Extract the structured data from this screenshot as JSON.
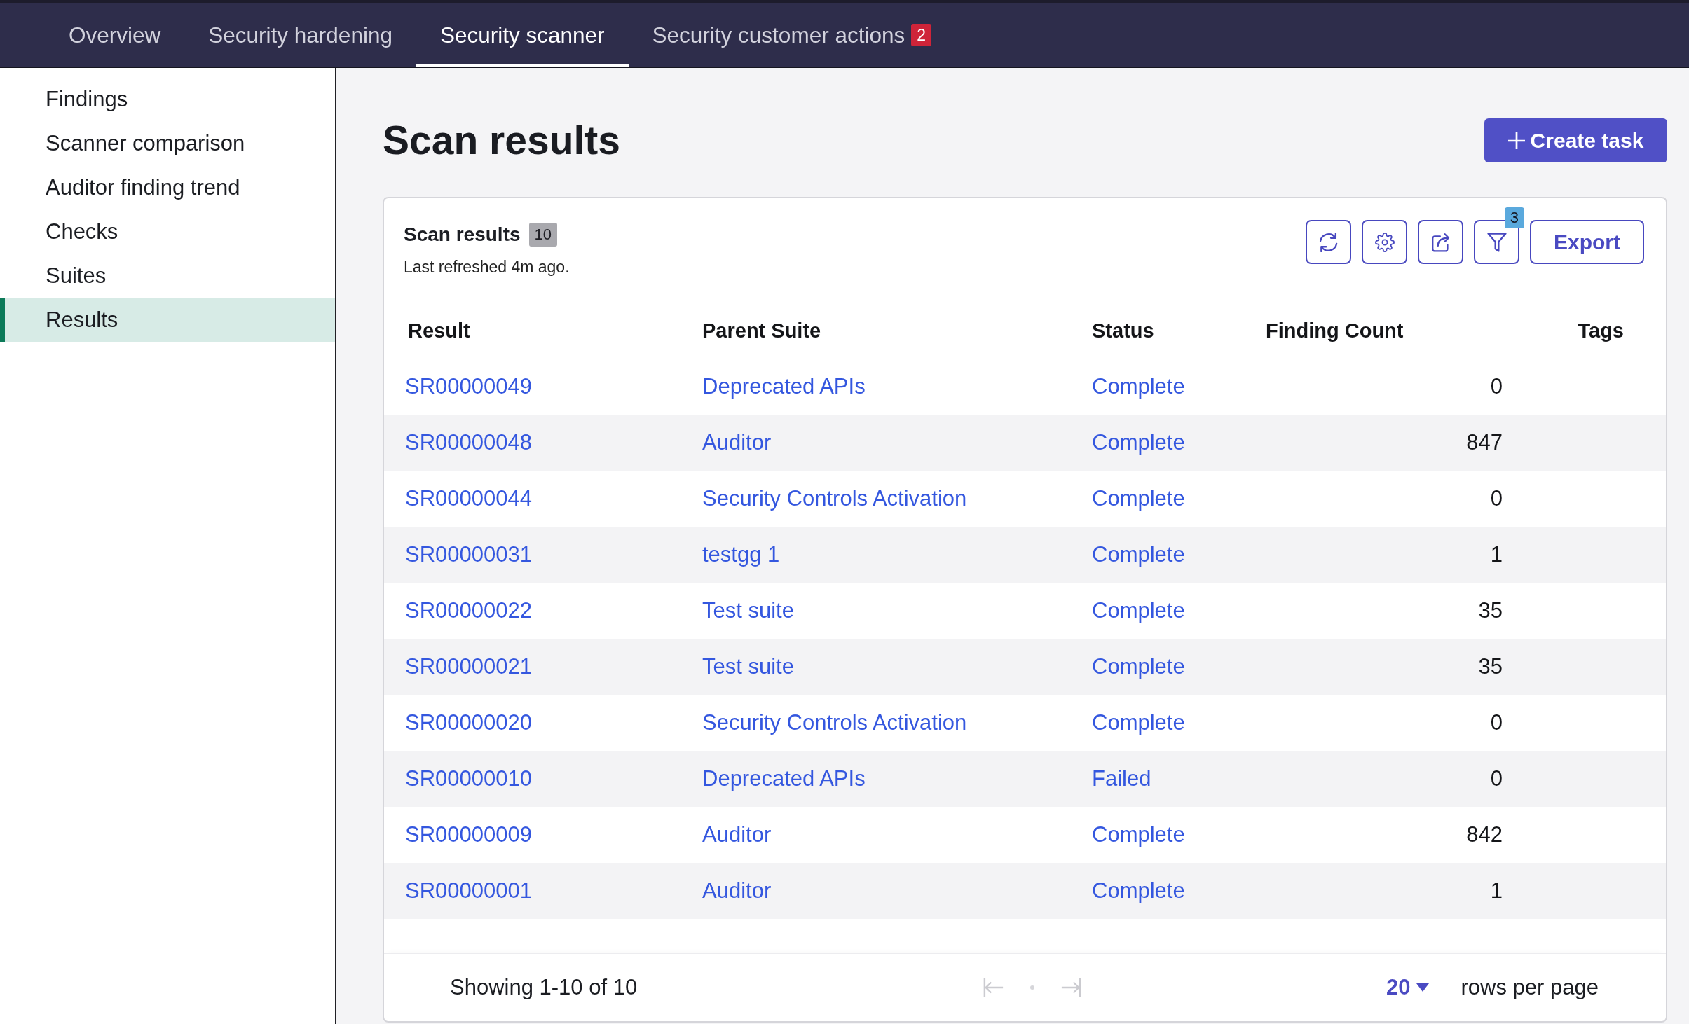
{
  "top_nav": {
    "tabs": [
      {
        "label": "Overview",
        "selected": false
      },
      {
        "label": "Security hardening",
        "selected": false
      },
      {
        "label": "Security scanner",
        "selected": true
      },
      {
        "label": "Security customer actions",
        "selected": false,
        "badge": "2"
      }
    ]
  },
  "sidebar": {
    "items": [
      {
        "label": "Findings",
        "selected": false
      },
      {
        "label": "Scanner comparison",
        "selected": false
      },
      {
        "label": "Auditor finding trend",
        "selected": false
      },
      {
        "label": "Checks",
        "selected": false
      },
      {
        "label": "Suites",
        "selected": false
      },
      {
        "label": "Results",
        "selected": true
      }
    ]
  },
  "page": {
    "title": "Scan results",
    "create_button": "Create task"
  },
  "card": {
    "title": "Scan results",
    "count": "10",
    "subtitle": "Last refreshed 4m ago.",
    "tools": [
      {
        "kind": "refresh"
      },
      {
        "kind": "settings"
      },
      {
        "kind": "share"
      },
      {
        "kind": "filter",
        "badge": "3"
      }
    ],
    "export_button": "Export"
  },
  "table": {
    "columns": [
      "Result",
      "Parent Suite",
      "Status",
      "Finding Count",
      "Tags"
    ],
    "rows": [
      {
        "result": "SR00000049",
        "parent_suite": "Deprecated APIs",
        "status": "Complete",
        "finding_count": "0"
      },
      {
        "result": "SR00000048",
        "parent_suite": "Auditor",
        "status": "Complete",
        "finding_count": "847"
      },
      {
        "result": "SR00000044",
        "parent_suite": "Security Controls Activation",
        "status": "Complete",
        "finding_count": "0"
      },
      {
        "result": "SR00000031",
        "parent_suite": "testgg 1",
        "status": "Complete",
        "finding_count": "1"
      },
      {
        "result": "SR00000022",
        "parent_suite": "Test suite",
        "status": "Complete",
        "finding_count": "35"
      },
      {
        "result": "SR00000021",
        "parent_suite": "Test suite",
        "status": "Complete",
        "finding_count": "35"
      },
      {
        "result": "SR00000020",
        "parent_suite": "Security Controls Activation",
        "status": "Complete",
        "finding_count": "0"
      },
      {
        "result": "SR00000010",
        "parent_suite": "Deprecated APIs",
        "status": "Failed",
        "finding_count": "0"
      },
      {
        "result": "SR00000009",
        "parent_suite": "Auditor",
        "status": "Complete",
        "finding_count": "842"
      },
      {
        "result": "SR00000001",
        "parent_suite": "Auditor",
        "status": "Complete",
        "finding_count": "1"
      }
    ]
  },
  "footer": {
    "showing": "Showing 1-10 of 10",
    "page_buttons": [
      {
        "kind": "first",
        "disabled": true
      },
      {
        "kind": "last",
        "disabled": true
      }
    ],
    "rows_per_page": "20",
    "rows_per_page_label": "rows per page"
  }
}
